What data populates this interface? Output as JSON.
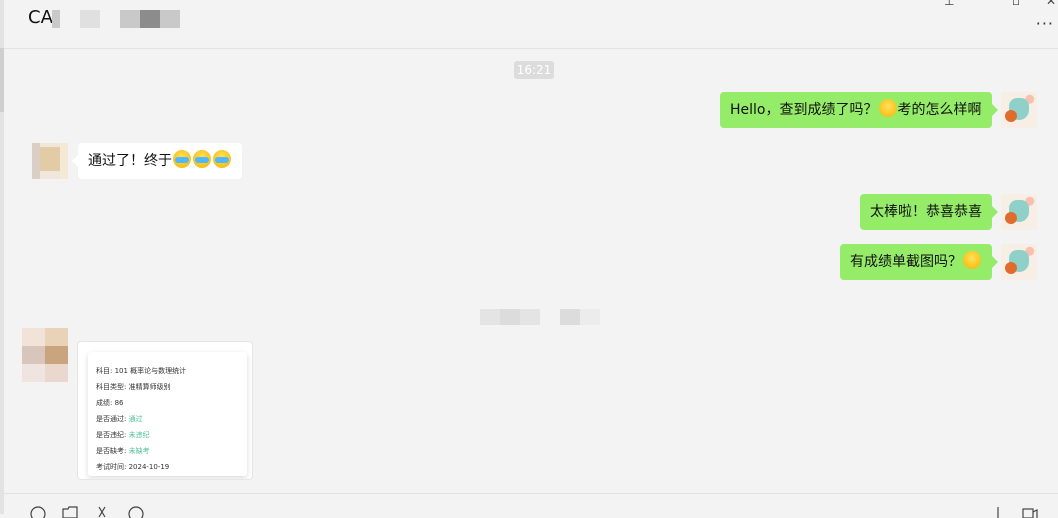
{
  "header": {
    "title": "CA"
  },
  "chat": {
    "timestamp": "16:21",
    "messages": [
      {
        "side": "me",
        "text": "Hello，查到成绩了吗？",
        "emoji": "confused-emoji",
        "text2": "考的怎么样啊"
      },
      {
        "side": "other",
        "text": "通过了！终于",
        "emoji": "crying-emoji"
      },
      {
        "side": "me",
        "text": "太棒啦！恭喜恭喜"
      },
      {
        "side": "me",
        "text": "有成绩单截图吗？",
        "emoji": "peeking-emoji"
      }
    ],
    "result_card": {
      "subject": "科目: 101 概率论与数理统计",
      "type": "科目类型: 准精算师级别",
      "score": "成绩: 86",
      "passed_label": "是否通过:",
      "passed_value": "通过",
      "violation_label": "是否违纪:",
      "violation_value": "未违纪",
      "absent_label": "是否缺考:",
      "absent_value": "未缺考",
      "exam_date": "考试时间:  2024-10-19"
    }
  },
  "colors": {
    "my_bubble": "#95ec69",
    "other_bubble": "#ffffff",
    "background": "#f3f3f3"
  },
  "window_controls": {
    "more": "···"
  }
}
